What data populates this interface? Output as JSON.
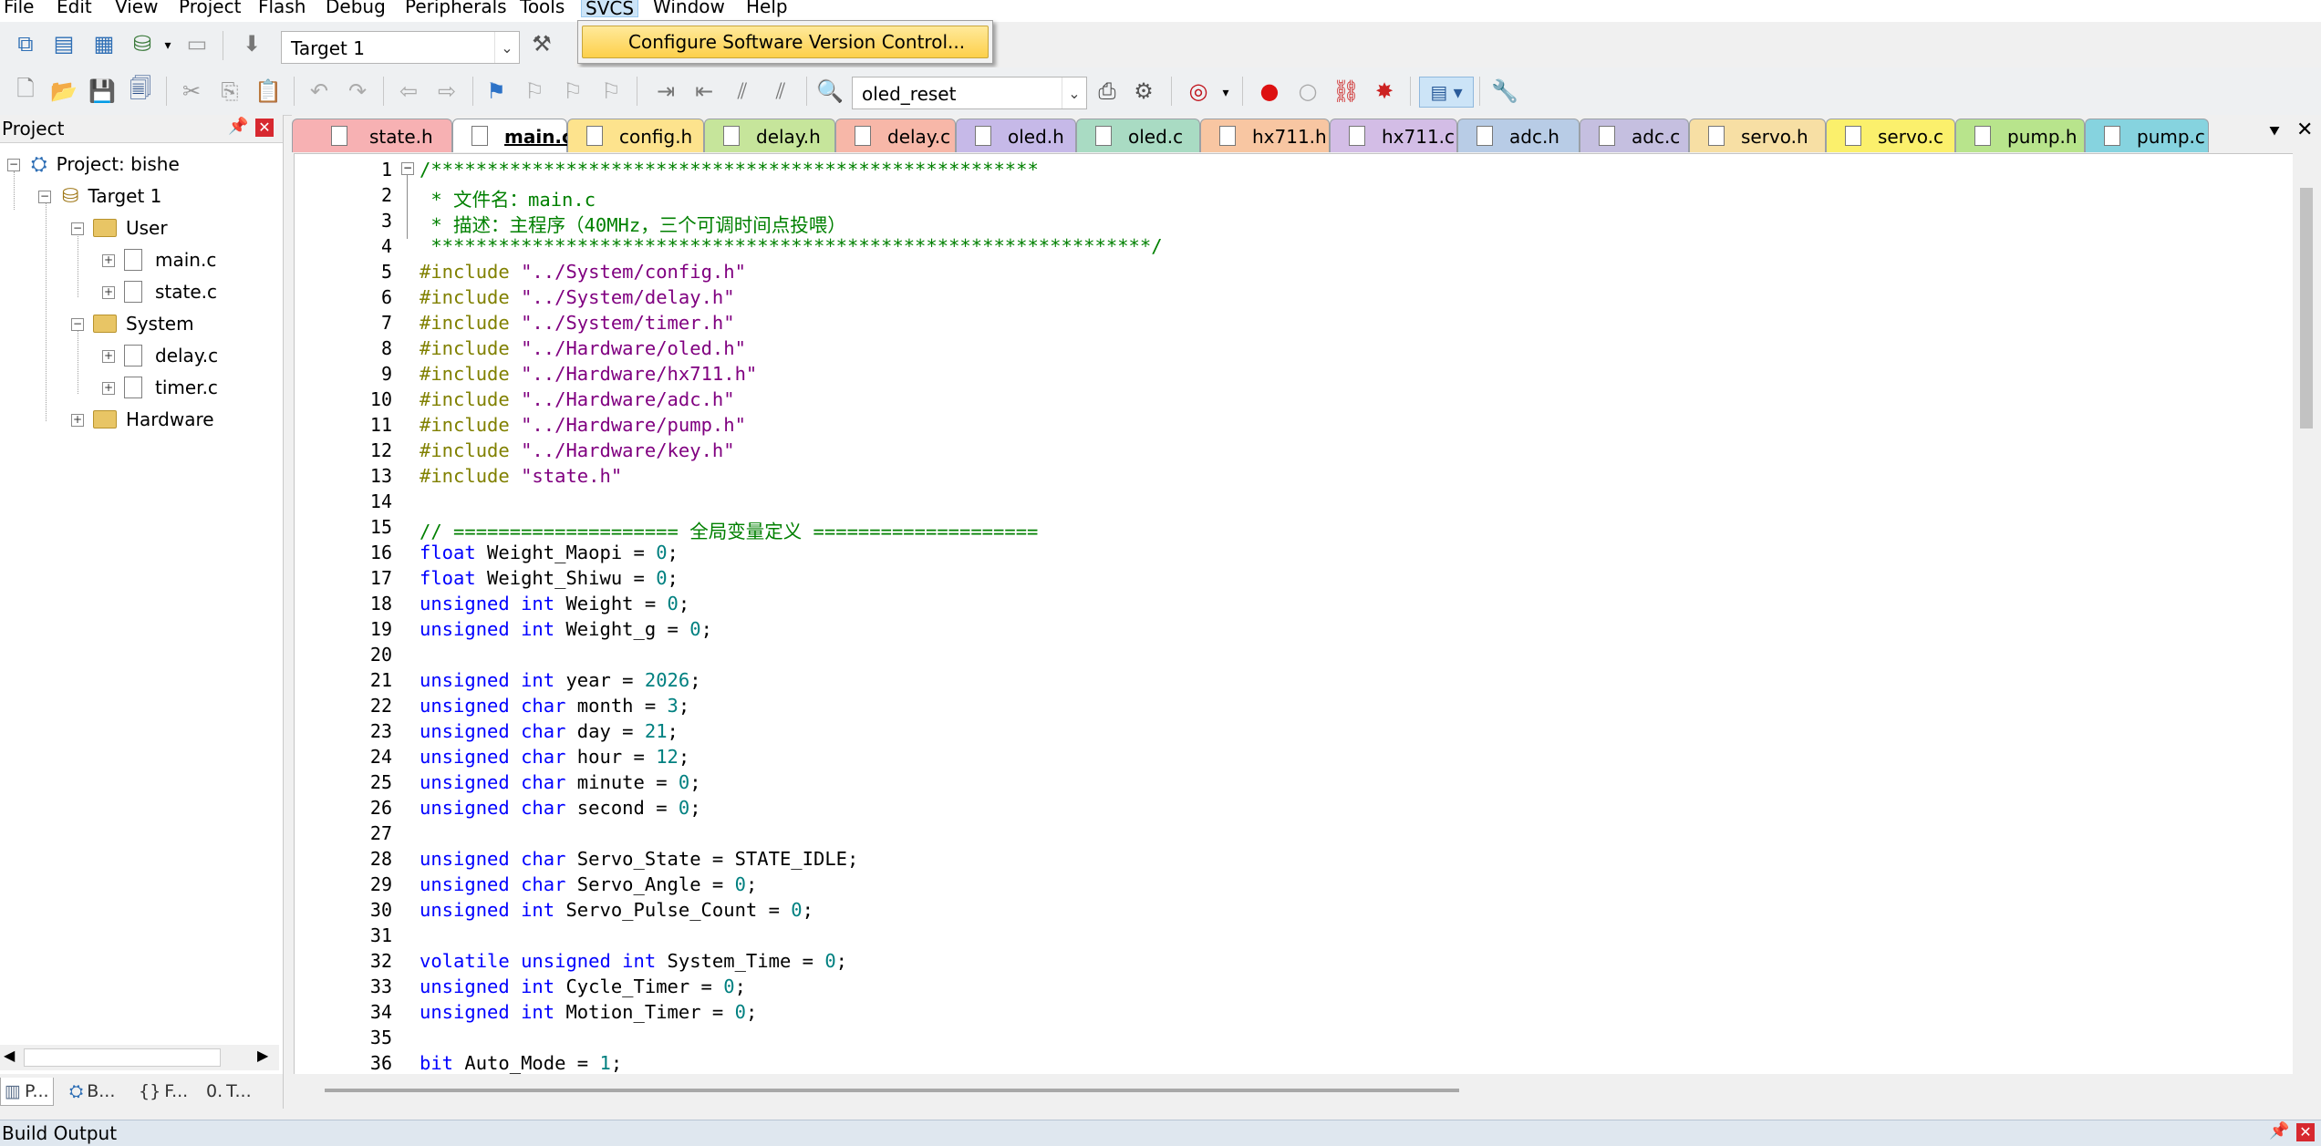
{
  "menu": {
    "items": [
      "File",
      "Edit",
      "View",
      "Project",
      "Flash",
      "Debug",
      "Peripherals",
      "Tools",
      "SVCS",
      "Window",
      "Help"
    ],
    "active": "SVCS",
    "dropdown_item": "Configure Software Version Control..."
  },
  "toolbar": {
    "target": "Target 1",
    "function_combo": "oled_reset"
  },
  "project_panel": {
    "title": "Project",
    "root": "Project: bishe",
    "target": "Target 1",
    "groups": [
      {
        "name": "User",
        "files": [
          "main.c",
          "state.c"
        ]
      },
      {
        "name": "System",
        "files": [
          "delay.c",
          "timer.c"
        ]
      },
      {
        "name": "Hardware",
        "files": []
      }
    ],
    "bottom_tabs": [
      "P...",
      "B...",
      "F...",
      "T..."
    ]
  },
  "tabs": [
    {
      "name": "state.h",
      "color": "#f7b1b3"
    },
    {
      "name": "main.c",
      "color": "#ffffff"
    },
    {
      "name": "config.h",
      "color": "#fde38d"
    },
    {
      "name": "delay.h",
      "color": "#c6e59b"
    },
    {
      "name": "delay.c",
      "color": "#f7b7a8"
    },
    {
      "name": "oled.h",
      "color": "#c6b9e8"
    },
    {
      "name": "oled.c",
      "color": "#a9dbc3"
    },
    {
      "name": "hx711.h",
      "color": "#f8c6a2"
    },
    {
      "name": "hx711.c",
      "color": "#d3bde6"
    },
    {
      "name": "adc.h",
      "color": "#b8cce6"
    },
    {
      "name": "adc.c",
      "color": "#c5bfe0"
    },
    {
      "name": "servo.h",
      "color": "#f7dfa4"
    },
    {
      "name": "servo.c",
      "color": "#fbf06c"
    },
    {
      "name": "pump.h",
      "color": "#b8e48c"
    },
    {
      "name": "pump.c",
      "color": "#86d3df"
    }
  ],
  "active_tab": "main.c",
  "code_lines": [
    [
      [
        "c-comment",
        "/******************************************************"
      ]
    ],
    [
      [
        "c-comment",
        " * 文件名：main.c"
      ]
    ],
    [
      [
        "c-comment",
        " * 描述：主程序（40MHz，三个可调时间点投喂）"
      ]
    ],
    [
      [
        "c-comment",
        " ****************************************************************/"
      ]
    ],
    [
      [
        "c-pre",
        "#include "
      ],
      [
        "c-str",
        "\"../System/config.h\""
      ]
    ],
    [
      [
        "c-pre",
        "#include "
      ],
      [
        "c-str",
        "\"../System/delay.h\""
      ]
    ],
    [
      [
        "c-pre",
        "#include "
      ],
      [
        "c-str",
        "\"../System/timer.h\""
      ]
    ],
    [
      [
        "c-pre",
        "#include "
      ],
      [
        "c-str",
        "\"../Hardware/oled.h\""
      ]
    ],
    [
      [
        "c-pre",
        "#include "
      ],
      [
        "c-str",
        "\"../Hardware/hx711.h\""
      ]
    ],
    [
      [
        "c-pre",
        "#include "
      ],
      [
        "c-str",
        "\"../Hardware/adc.h\""
      ]
    ],
    [
      [
        "c-pre",
        "#include "
      ],
      [
        "c-str",
        "\"../Hardware/pump.h\""
      ]
    ],
    [
      [
        "c-pre",
        "#include "
      ],
      [
        "c-str",
        "\"../Hardware/key.h\""
      ]
    ],
    [
      [
        "c-pre",
        "#include "
      ],
      [
        "c-str",
        "\"state.h\""
      ]
    ],
    [],
    [
      [
        "c-comment",
        "// ==================== 全局变量定义 ===================="
      ]
    ],
    [
      [
        "c-kw",
        "float"
      ],
      [
        "c-plain",
        " Weight_Maopi = "
      ],
      [
        "c-num",
        "0"
      ],
      [
        "c-plain",
        ";"
      ]
    ],
    [
      [
        "c-kw",
        "float"
      ],
      [
        "c-plain",
        " Weight_Shiwu = "
      ],
      [
        "c-num",
        "0"
      ],
      [
        "c-plain",
        ";"
      ]
    ],
    [
      [
        "c-kw",
        "unsigned int"
      ],
      [
        "c-plain",
        " Weight = "
      ],
      [
        "c-num",
        "0"
      ],
      [
        "c-plain",
        ";"
      ]
    ],
    [
      [
        "c-kw",
        "unsigned int"
      ],
      [
        "c-plain",
        " Weight_g = "
      ],
      [
        "c-num",
        "0"
      ],
      [
        "c-plain",
        ";"
      ]
    ],
    [],
    [
      [
        "c-kw",
        "unsigned int"
      ],
      [
        "c-plain",
        " year = "
      ],
      [
        "c-num",
        "2026"
      ],
      [
        "c-plain",
        ";"
      ]
    ],
    [
      [
        "c-kw",
        "unsigned char"
      ],
      [
        "c-plain",
        " month = "
      ],
      [
        "c-num",
        "3"
      ],
      [
        "c-plain",
        ";"
      ]
    ],
    [
      [
        "c-kw",
        "unsigned char"
      ],
      [
        "c-plain",
        " day = "
      ],
      [
        "c-num",
        "21"
      ],
      [
        "c-plain",
        ";"
      ]
    ],
    [
      [
        "c-kw",
        "unsigned char"
      ],
      [
        "c-plain",
        " hour = "
      ],
      [
        "c-num",
        "12"
      ],
      [
        "c-plain",
        ";"
      ]
    ],
    [
      [
        "c-kw",
        "unsigned char"
      ],
      [
        "c-plain",
        " minute = "
      ],
      [
        "c-num",
        "0"
      ],
      [
        "c-plain",
        ";"
      ]
    ],
    [
      [
        "c-kw",
        "unsigned char"
      ],
      [
        "c-plain",
        " second = "
      ],
      [
        "c-num",
        "0"
      ],
      [
        "c-plain",
        ";"
      ]
    ],
    [],
    [
      [
        "c-kw",
        "unsigned char"
      ],
      [
        "c-plain",
        " Servo_State = STATE_IDLE;"
      ]
    ],
    [
      [
        "c-kw",
        "unsigned char"
      ],
      [
        "c-plain",
        " Servo_Angle = "
      ],
      [
        "c-num",
        "0"
      ],
      [
        "c-plain",
        ";"
      ]
    ],
    [
      [
        "c-kw",
        "unsigned int"
      ],
      [
        "c-plain",
        " Servo_Pulse_Count = "
      ],
      [
        "c-num",
        "0"
      ],
      [
        "c-plain",
        ";"
      ]
    ],
    [],
    [
      [
        "c-kw",
        "volatile unsigned int"
      ],
      [
        "c-plain",
        " System_Time = "
      ],
      [
        "c-num",
        "0"
      ],
      [
        "c-plain",
        ";"
      ]
    ],
    [
      [
        "c-kw",
        "unsigned int"
      ],
      [
        "c-plain",
        " Cycle_Timer = "
      ],
      [
        "c-num",
        "0"
      ],
      [
        "c-plain",
        ";"
      ]
    ],
    [
      [
        "c-kw",
        "unsigned int"
      ],
      [
        "c-plain",
        " Motion_Timer = "
      ],
      [
        "c-num",
        "0"
      ],
      [
        "c-plain",
        ";"
      ]
    ],
    [],
    [
      [
        "c-kw",
        "bit"
      ],
      [
        "c-plain",
        " Auto_Mode = "
      ],
      [
        "c-num",
        "1"
      ],
      [
        "c-plain",
        ";"
      ]
    ]
  ],
  "build_output": {
    "title": "Build Output"
  },
  "colors": {
    "accent": "#fdd04b",
    "active_menu": "#cce4f7"
  }
}
